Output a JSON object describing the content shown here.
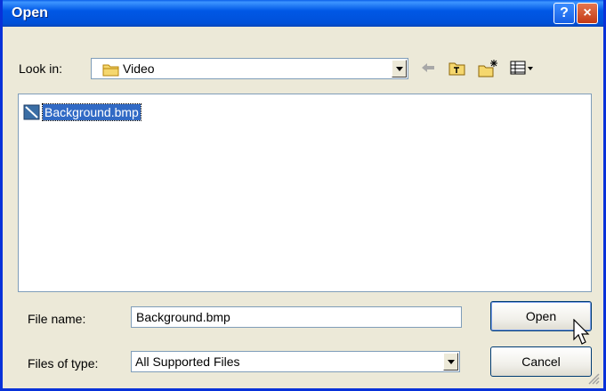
{
  "window": {
    "title": "Open",
    "help_glyph": "?",
    "close_glyph": "×"
  },
  "lookin": {
    "label": "Look in:",
    "value": "Video"
  },
  "toolbar": {
    "icons": [
      "back-arrow-icon",
      "up-folder-icon",
      "new-folder-icon",
      "view-menu-icon"
    ]
  },
  "files": [
    {
      "name": "Background.bmp",
      "selected": true
    }
  ],
  "filename": {
    "label": "File name:",
    "value": "Background.bmp"
  },
  "filetype": {
    "label": "Files of type:",
    "value": "All Supported Files"
  },
  "buttons": {
    "open": "Open",
    "cancel": "Cancel"
  },
  "colors": {
    "titlebar": "#0058E6",
    "selection": "#316AC5",
    "dialog_bg": "#ECE9D8"
  }
}
